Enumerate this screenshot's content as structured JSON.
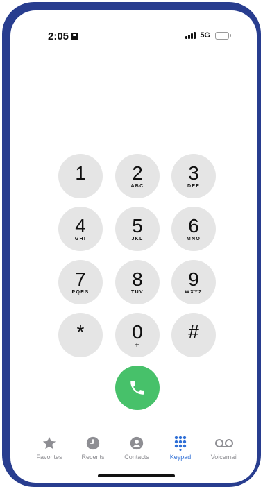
{
  "status": {
    "time": "2:05",
    "network": "5G"
  },
  "keypad": {
    "keys": [
      {
        "digit": "1",
        "letters": ""
      },
      {
        "digit": "2",
        "letters": "ABC"
      },
      {
        "digit": "3",
        "letters": "DEF"
      },
      {
        "digit": "4",
        "letters": "GHI"
      },
      {
        "digit": "5",
        "letters": "JKL"
      },
      {
        "digit": "6",
        "letters": "MNO"
      },
      {
        "digit": "7",
        "letters": "PQRS"
      },
      {
        "digit": "8",
        "letters": "TUV"
      },
      {
        "digit": "9",
        "letters": "WXYZ"
      },
      {
        "digit": "*",
        "letters": ""
      },
      {
        "digit": "0",
        "letters": "+"
      },
      {
        "digit": "#",
        "letters": ""
      }
    ]
  },
  "tabs": [
    {
      "label": "Favorites",
      "icon": "star-icon"
    },
    {
      "label": "Recents",
      "icon": "clock-icon"
    },
    {
      "label": "Contacts",
      "icon": "person-icon"
    },
    {
      "label": "Keypad",
      "icon": "keypad-icon",
      "active": true
    },
    {
      "label": "Voicemail",
      "icon": "voicemail-icon"
    }
  ],
  "colors": {
    "frame": "#283d8f",
    "call": "#47c16a",
    "active_tab": "#2f6fd6",
    "key_bg": "#e5e5e5"
  }
}
